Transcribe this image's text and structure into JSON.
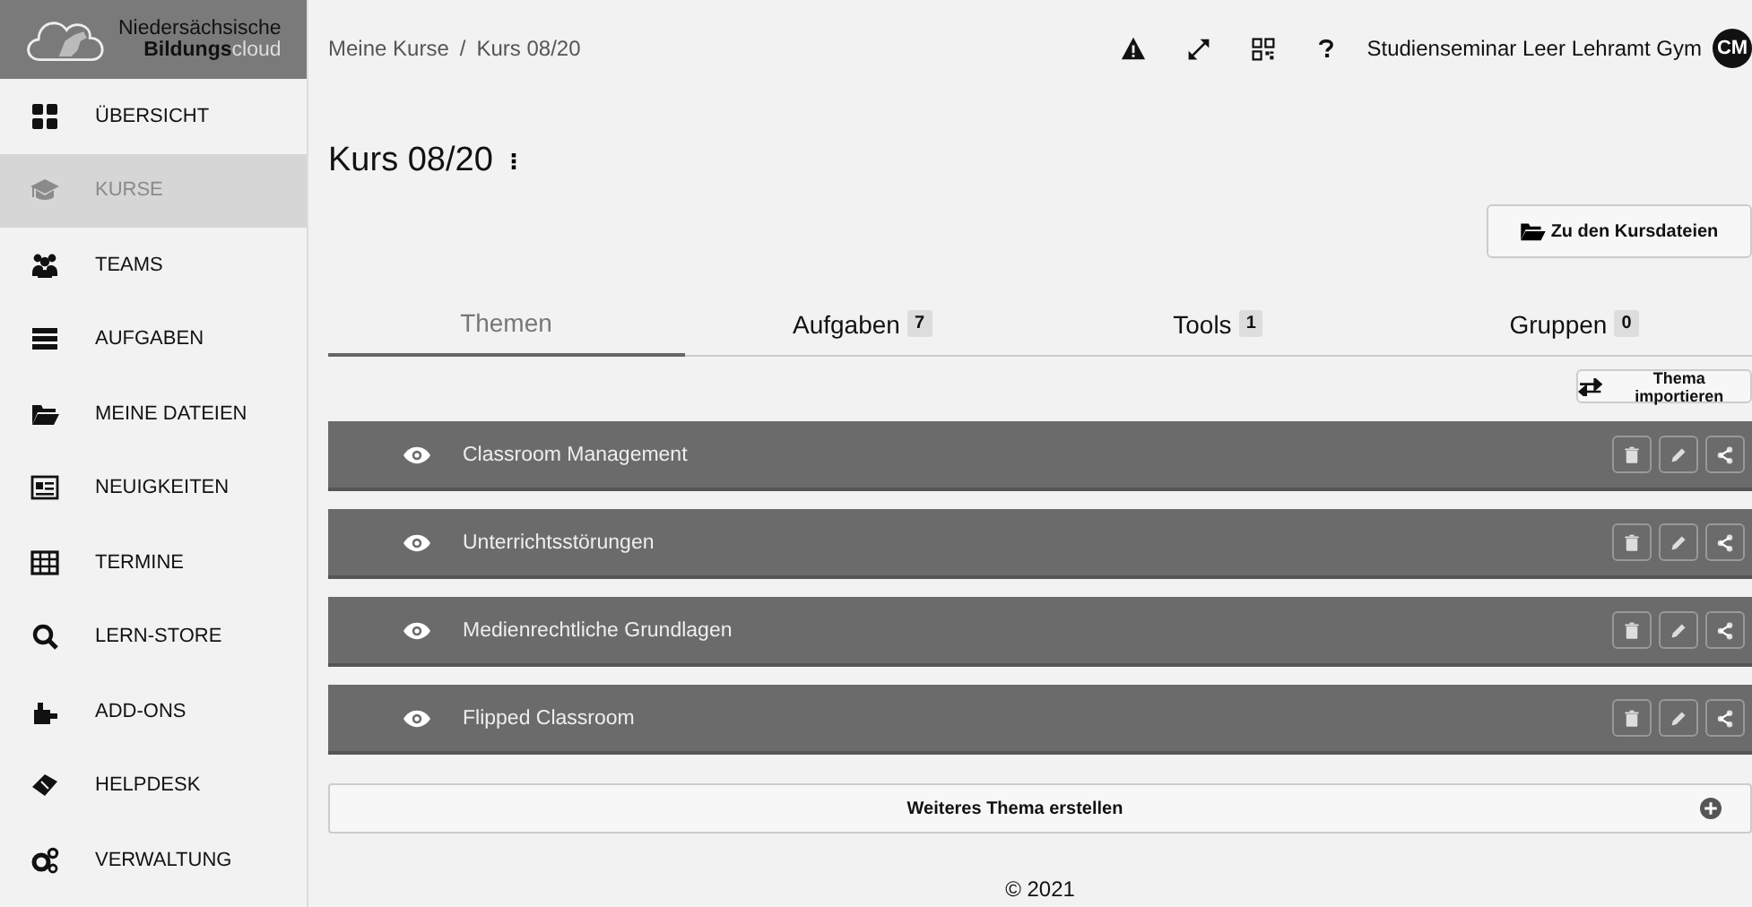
{
  "logo": {
    "line_1": "Niedersächsische",
    "line_2_bold": "Bildungs",
    "line_2_light": "cloud"
  },
  "sidebar": {
    "items": [
      {
        "label": "ÜBERSICHT",
        "selected": false
      },
      {
        "label": "KURSE",
        "selected": true
      },
      {
        "label": "TEAMS",
        "selected": false
      },
      {
        "label": "AUFGABEN",
        "selected": false
      },
      {
        "label": "MEINE DATEIEN",
        "selected": false
      },
      {
        "label": "NEUIGKEITEN",
        "selected": false
      },
      {
        "label": "TERMINE",
        "selected": false
      },
      {
        "label": "LERN-STORE",
        "selected": false
      },
      {
        "label": "ADD-ONS",
        "selected": false
      },
      {
        "label": "HELPDESK",
        "selected": false
      },
      {
        "label": "VERWALTUNG",
        "selected": false
      }
    ]
  },
  "breadcrumb": [
    "Meine Kurse",
    "/",
    "Kurs 08/20"
  ],
  "header": {
    "user": "Studienseminar Leer Lehramt Gym",
    "avatar": "CM"
  },
  "course": {
    "title": "Kurs 08/20",
    "files_button": "Zu den Kursdateien"
  },
  "tabs": [
    {
      "label": "Themen",
      "selected": true
    },
    {
      "label": "Aufgaben",
      "count": "7",
      "selected": false
    },
    {
      "label": "Tools",
      "count": "1",
      "selected": false
    },
    {
      "label": "Gruppen",
      "count": "0",
      "selected": false
    }
  ],
  "import_button": "Thema importieren",
  "topics": [
    {
      "title": "Classroom Management"
    },
    {
      "title": "Unterrichtsstörungen"
    },
    {
      "title": "Medienrechtliche Grundlagen"
    },
    {
      "title": "Flipped Classroom"
    }
  ],
  "add_topic_button": "Weiteres Thema erstellen",
  "footer": "© 2021"
}
